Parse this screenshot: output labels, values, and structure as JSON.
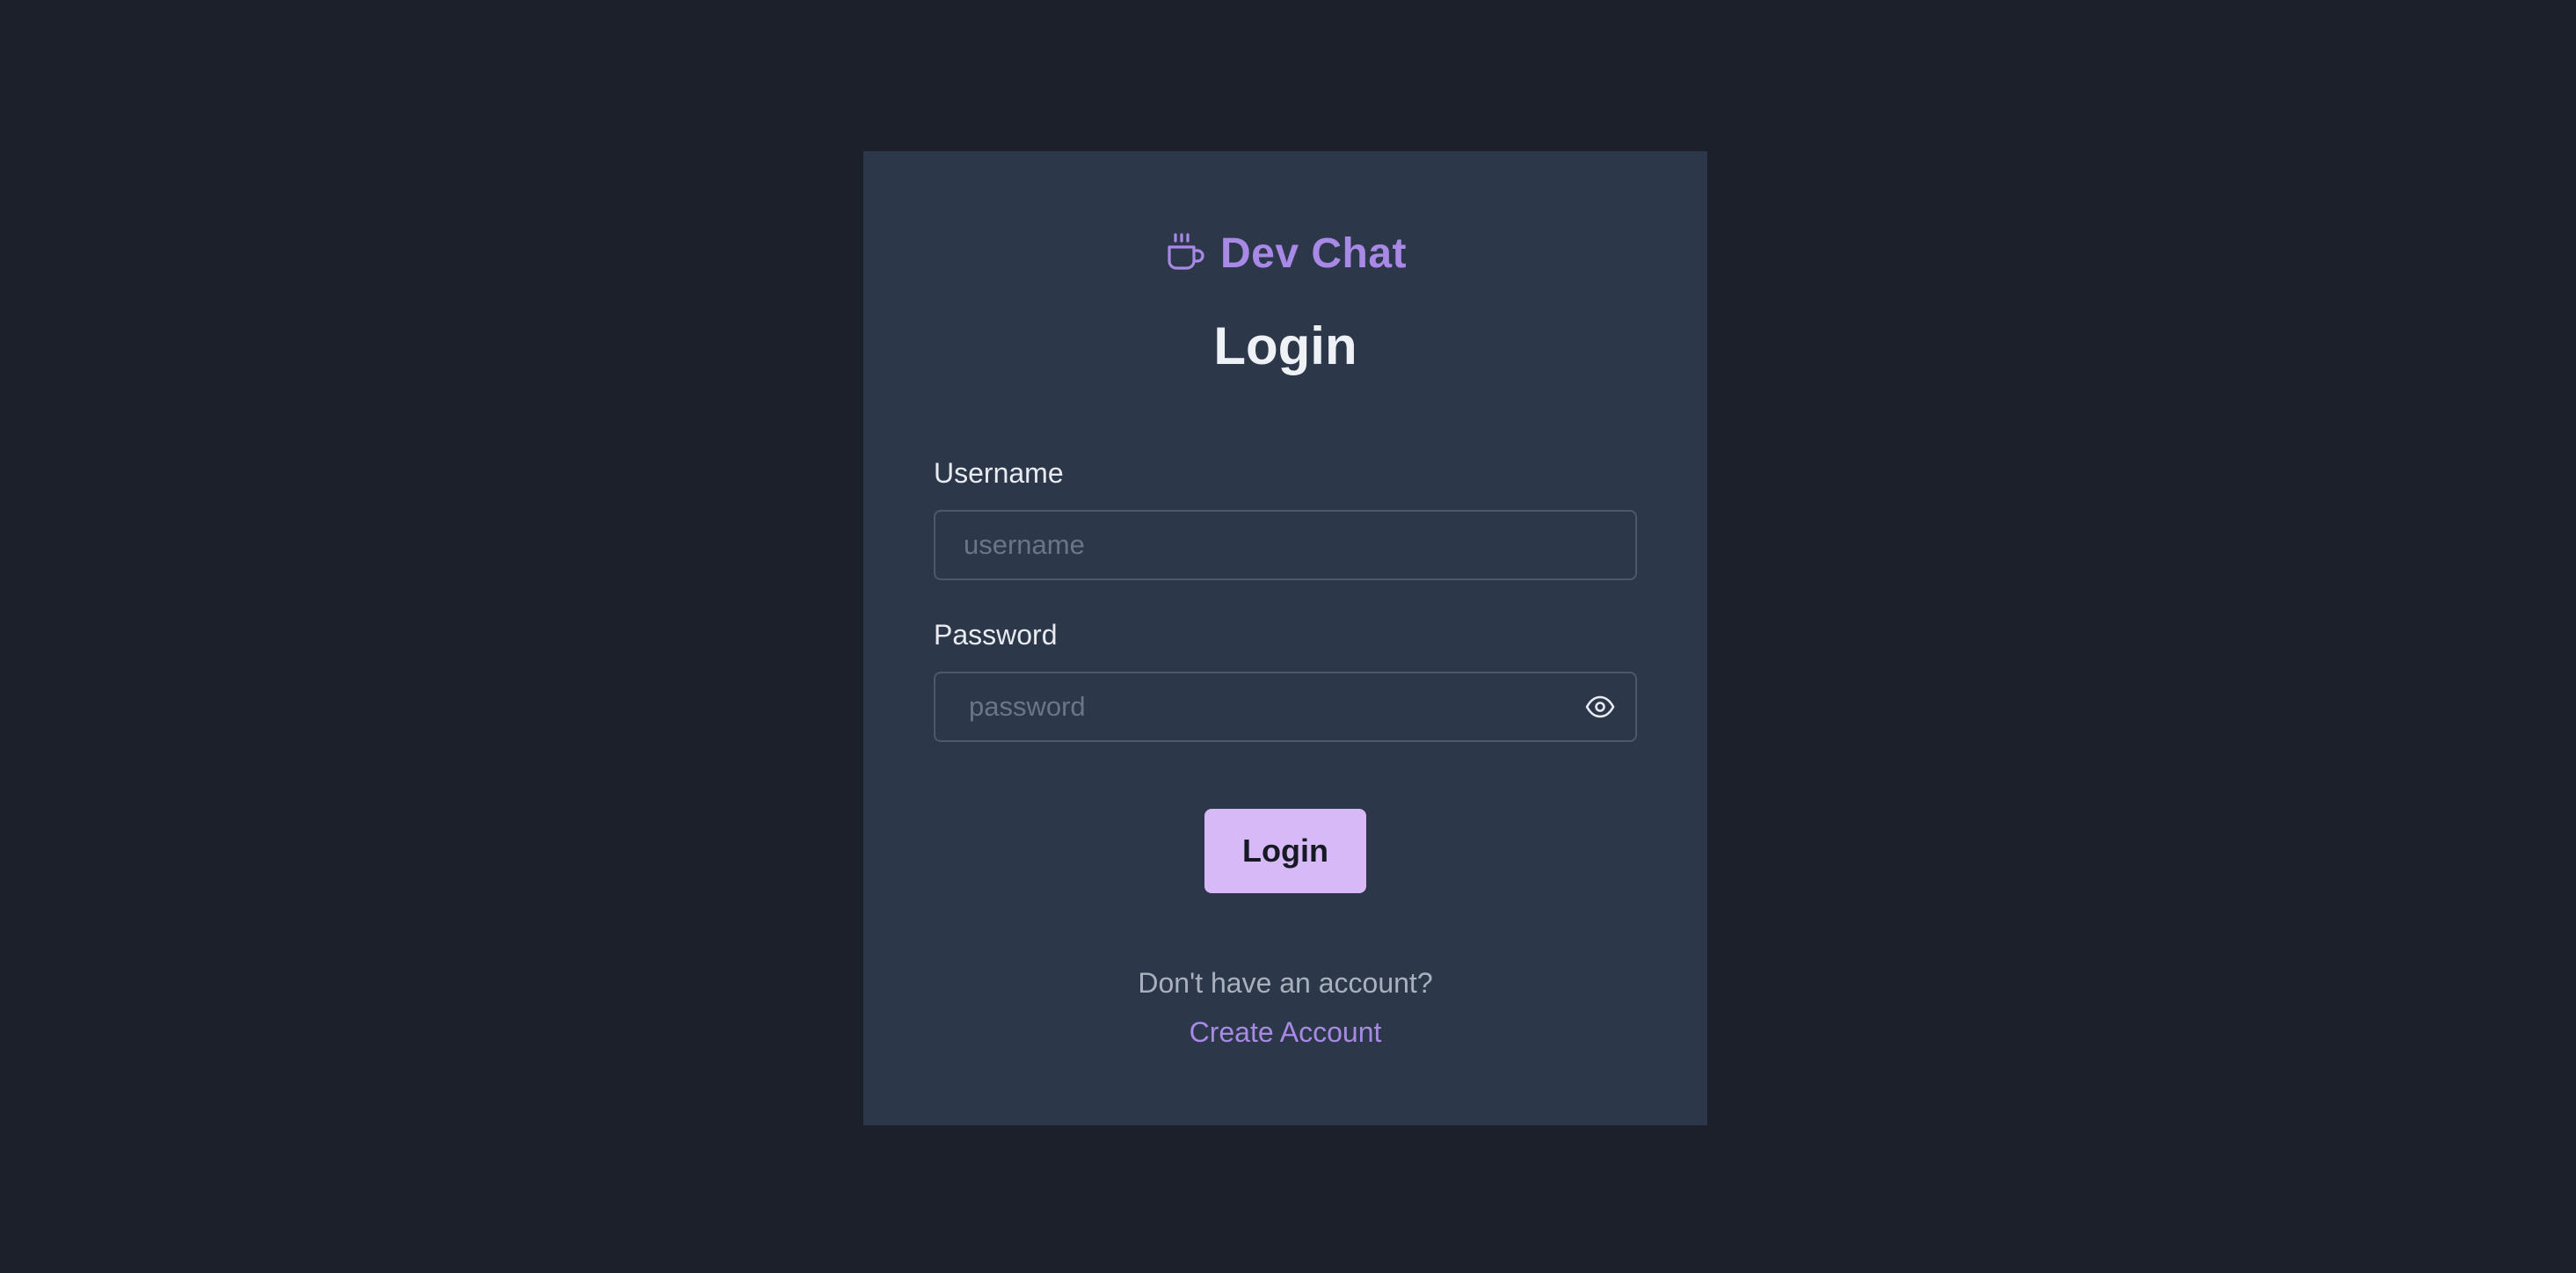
{
  "brand": {
    "name": "Dev Chat",
    "icon": "coffee-cup-icon",
    "color": "#a889e6"
  },
  "form": {
    "heading": "Login",
    "username": {
      "label": "Username",
      "value": "",
      "placeholder": "username"
    },
    "password": {
      "label": "Password",
      "value": "",
      "placeholder": "password",
      "toggle_icon": "eye-icon"
    },
    "submit_label": "Login"
  },
  "footer": {
    "prompt": "Don't have an account?",
    "create_account_label": "Create Account"
  },
  "colors": {
    "page_background": "#1c202b",
    "card_background": "#2c3749",
    "accent": "#a889e6",
    "button_background": "#d8b9f7"
  }
}
